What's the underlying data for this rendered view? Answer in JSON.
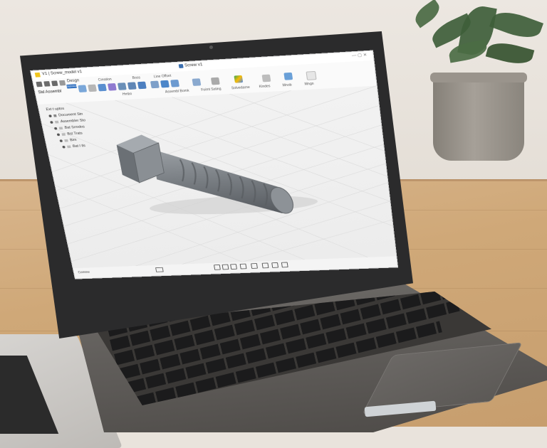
{
  "app": {
    "document_title": "V1 | Screw_model v1",
    "center_title": "Screw v1",
    "window_controls": "— ▢ ✕"
  },
  "toolbar": {
    "workspace_button": "Std Assembl",
    "design_tab": "Desgn",
    "design_mode": "DEFAULT",
    "groups": [
      {
        "label": "Creation"
      },
      {
        "label": "Boss"
      },
      {
        "label": "Line Offset"
      }
    ],
    "sub_labels": [
      "Hmbo",
      "Assembl Bomk",
      "Foimt Ssting",
      "Solvedarne",
      "Kindes",
      "Mnob",
      "Mngn"
    ]
  },
  "browser": {
    "header": "Ext t uptos",
    "items": [
      {
        "label": "Document Stn"
      },
      {
        "label": "Assembler Sto"
      },
      {
        "label": "Bat Srmdos"
      },
      {
        "label": "Bst Trats"
      },
      {
        "label": "Bim"
      },
      {
        "label": "Bat I tls"
      }
    ]
  },
  "bottom": {
    "comments": "Comme"
  },
  "colors": {
    "accent": "#2f6fbf",
    "logo": "#f0c51e",
    "model": "#7c8186",
    "viewport_bg": "#eeeeee"
  }
}
